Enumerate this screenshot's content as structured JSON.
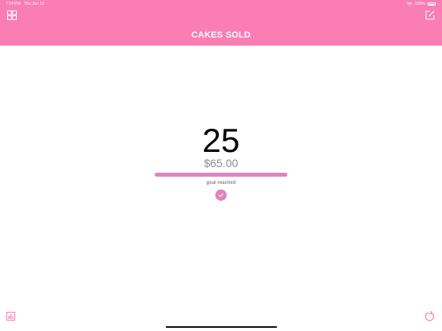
{
  "status_bar": {
    "time": "7:14 PM",
    "date": "Thu Jun 13",
    "battery": "100%"
  },
  "header": {
    "title": "CAKES SOLD"
  },
  "counter": {
    "count": "25",
    "amount": "$65.00",
    "goal_text": "goal reached",
    "progress_fraction": 1.0
  },
  "icons": [
    "grid-icon",
    "edit-icon",
    "checkmark-icon",
    "stats-icon",
    "reset-icon"
  ],
  "colors": {
    "accent": "#fa7db4",
    "progress": "#d988bc",
    "check": "#e083b9",
    "secondary_text": "#8e8e93"
  }
}
